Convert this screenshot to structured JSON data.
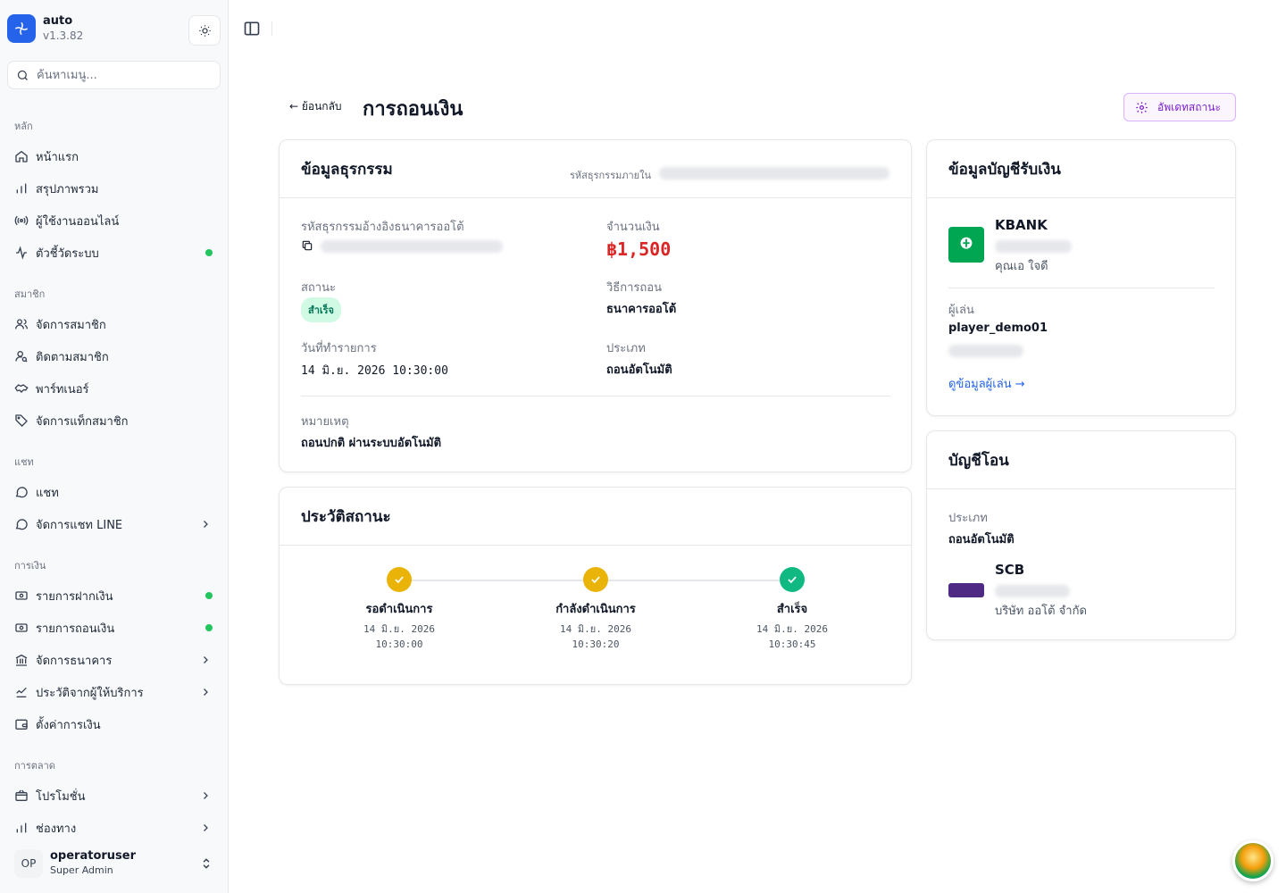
{
  "app": {
    "name": "auto",
    "version": "v1.3.82"
  },
  "search": {
    "placeholder": "ค้นหาเมนู..."
  },
  "nav": {
    "sections": [
      {
        "title": "หลัก",
        "items": [
          {
            "label": "หน้าแรก",
            "icon": "home-icon"
          },
          {
            "label": "สรุปภาพรวม",
            "icon": "bar-chart-icon"
          },
          {
            "label": "ผู้ใช้งานออนไลน์",
            "icon": "broadcast-icon"
          },
          {
            "label": "ตัวชี้วัดระบบ",
            "icon": "activity-icon",
            "dot": true
          }
        ]
      },
      {
        "title": "สมาชิก",
        "items": [
          {
            "label": "จัดการสมาชิก",
            "icon": "users-icon"
          },
          {
            "label": "ติดตามสมาชิก",
            "icon": "user-search-icon"
          },
          {
            "label": "พาร์ทเนอร์",
            "icon": "handshake-icon"
          },
          {
            "label": "จัดการแท็กสมาชิก",
            "icon": "tag-icon"
          }
        ]
      },
      {
        "title": "แชท",
        "items": [
          {
            "label": "แชท",
            "icon": "chat-icon"
          },
          {
            "label": "จัดการแชท LINE",
            "icon": "chat-icon",
            "chevron": true
          }
        ]
      },
      {
        "title": "การเงิน",
        "items": [
          {
            "label": "รายการฝากเงิน",
            "icon": "deposit-icon",
            "dot": true
          },
          {
            "label": "รายการถอนเงิน",
            "icon": "withdraw-icon",
            "dot": true
          },
          {
            "label": "จัดการธนาคาร",
            "icon": "bank-icon",
            "chevron": true
          },
          {
            "label": "ประวัติจากผู้ให้บริการ",
            "icon": "provider-history-icon",
            "chevron": true
          },
          {
            "label": "ตั้งค่าการเงิน",
            "icon": "wallet-icon"
          }
        ]
      },
      {
        "title": "การตลาด",
        "items": [
          {
            "label": "โปรโมชั่น",
            "icon": "promotion-icon",
            "chevron": true
          },
          {
            "label": "ช่องทาง",
            "icon": "bar-chart-icon",
            "chevron": true
          }
        ]
      }
    ]
  },
  "user": {
    "initials": "OP",
    "name": "operatoruser",
    "role": "Super Admin"
  },
  "header": {
    "back_label": "← ย้อนกลับ",
    "title": "การถอนเงิน",
    "update_label": "อัพเดทสถานะ"
  },
  "transaction": {
    "title": "ข้อมูลธุรกรรม",
    "internal_id_label": "รหัสธุรกรรมภายใน",
    "bank_ref_label": "รหัสธุรกรรมอ้างอิงธนาคารออโต้",
    "amount_label": "จำนวนเงิน",
    "amount": "฿1,500",
    "status_label": "สถานะ",
    "status": "สำเร็จ",
    "method_label": "วิธีการถอน",
    "method": "ธนาคารออโต้",
    "date_label": "วันที่ทำรายการ",
    "date": "14 มิ.ย. 2026 10:30:00",
    "type_label": "ประเภท",
    "type": "ถอนอัตโนมัติ",
    "note_label": "หมายเหตุ",
    "note": "ถอนปกติ ผ่านระบบอัตโนมัติ"
  },
  "history": {
    "title": "ประวัติสถานะ",
    "steps": [
      {
        "label": "รอดำเนินการ",
        "date": "14 มิ.ย. 2026",
        "time": "10:30:00",
        "color": "#eab308"
      },
      {
        "label": "กำลังดำเนินการ",
        "date": "14 มิ.ย. 2026",
        "time": "10:30:20",
        "color": "#eab308"
      },
      {
        "label": "สำเร็จ",
        "date": "14 มิ.ย. 2026",
        "time": "10:30:45",
        "color": "#10b981"
      }
    ]
  },
  "receiver": {
    "title": "ข้อมูลบัญชีรับเงิน",
    "bank": "KBANK",
    "account_name": "คุณเอ ใจดี",
    "player_label": "ผู้เล่น",
    "player": "player_demo01",
    "view_player": "ดูข้อมูลผู้เล่น →"
  },
  "transfer": {
    "title": "บัญชีโอน",
    "type_label": "ประเภท",
    "type": "ถอนอัตโนมัติ",
    "bank": "SCB",
    "account_name": "บริษัท ออโต้ จำกัด"
  },
  "colors": {
    "primary": "#2563eb",
    "amount": "#dc2626",
    "link": "#2563eb",
    "success": "#10b981",
    "pending": "#eab308"
  }
}
